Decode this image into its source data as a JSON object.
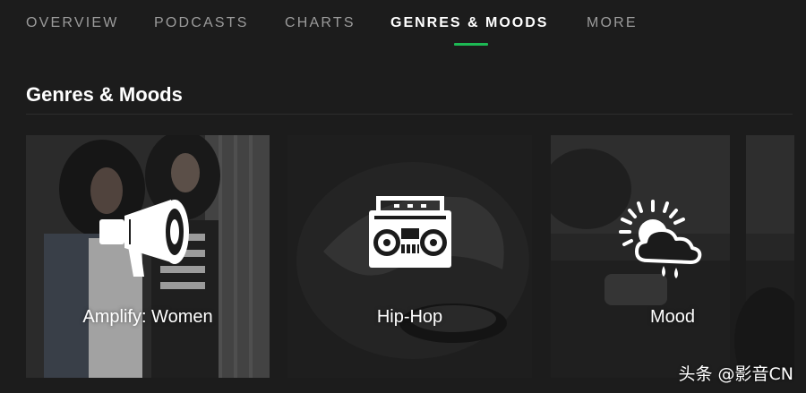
{
  "nav": {
    "tabs": [
      {
        "label": "OVERVIEW"
      },
      {
        "label": "PODCASTS"
      },
      {
        "label": "CHARTS"
      },
      {
        "label": "GENRES & MOODS"
      },
      {
        "label": "MORE"
      }
    ],
    "active_tab": "GENRES & MOODS",
    "accent_color": "#1db954"
  },
  "section": {
    "title": "Genres & Moods"
  },
  "cards": [
    {
      "label": "Amplify: Women",
      "icon": "megaphone-icon"
    },
    {
      "label": "Hip-Hop",
      "icon": "boombox-icon"
    },
    {
      "label": "Mood",
      "icon": "sun-cloud-rain-icon"
    }
  ],
  "watermark": {
    "text": "头条 @影音CN"
  }
}
